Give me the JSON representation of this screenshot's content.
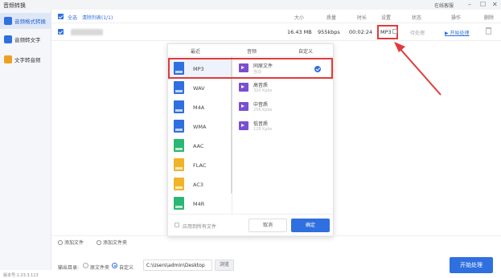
{
  "app": {
    "title": "音频转换",
    "online_help": "在线客服"
  },
  "window_controls": {
    "minimize": "–",
    "maximize": "☐",
    "close": "✕"
  },
  "sidebar": {
    "items": [
      {
        "label": "音频格式转换",
        "icon": "music-convert-icon",
        "color": "#2f6fe0",
        "active": true
      },
      {
        "label": "音频转文字",
        "icon": "audio-text-icon",
        "color": "#2f6fe0",
        "active": false
      },
      {
        "label": "文字转音频",
        "icon": "text-audio-icon",
        "color": "#f0a020",
        "active": false
      }
    ]
  },
  "table": {
    "headers": {
      "select_all": "全选",
      "clear_list": "清除列表(1/1)",
      "size": "大小",
      "quality": "质量",
      "duration": "时长",
      "setting": "设置",
      "status": "状态",
      "operation": "操作",
      "delete": "删除"
    },
    "rows": [
      {
        "size": "16.43 MB",
        "quality": "955kbps",
        "duration": "00:02:24",
        "setting": "MP3",
        "status": "待处理",
        "action": "▶ 开始处理"
      }
    ]
  },
  "format_popup": {
    "tabs": [
      "最近",
      "音频",
      "自定义"
    ],
    "formats": [
      {
        "label": "MP3",
        "color": "#2f6fe0",
        "selected": true
      },
      {
        "label": "WAV",
        "color": "#2f6fe0",
        "selected": false
      },
      {
        "label": "M4A",
        "color": "#2f6fe0",
        "selected": false
      },
      {
        "label": "WMA",
        "color": "#2f6fe0",
        "selected": false
      },
      {
        "label": "AAC",
        "color": "#2bb673",
        "selected": false
      },
      {
        "label": "FLAC",
        "color": "#f0b429",
        "selected": false
      },
      {
        "label": "AC3",
        "color": "#f0b429",
        "selected": false
      },
      {
        "label": "M4R",
        "color": "#2bb673",
        "selected": false
      }
    ],
    "qualities": [
      {
        "name": "同原文件",
        "bitrate": "自动",
        "selected": true
      },
      {
        "name": "高音质",
        "bitrate": "320 Kpbs",
        "selected": false
      },
      {
        "name": "中音质",
        "bitrate": "256 Kpbs",
        "selected": false
      },
      {
        "name": "低音质",
        "bitrate": "128 Kpbs",
        "selected": false
      }
    ],
    "apply_all_label": "应用到所有文件",
    "cancel_label": "取消",
    "confirm_label": "确定"
  },
  "bottom": {
    "add_file": "添加文件",
    "add_folder": "添加文件夹",
    "output_label": "输出目录:",
    "radio_original": "原文件夹",
    "radio_custom": "自定义",
    "output_path": "C:\\Users\\admin\\Desktop",
    "browse": "浏览",
    "start_button": "开始处理"
  },
  "version": "版本号:1.23.3.113",
  "colors": {
    "accent": "#2f6fe0",
    "highlight": "#e03b3b"
  }
}
